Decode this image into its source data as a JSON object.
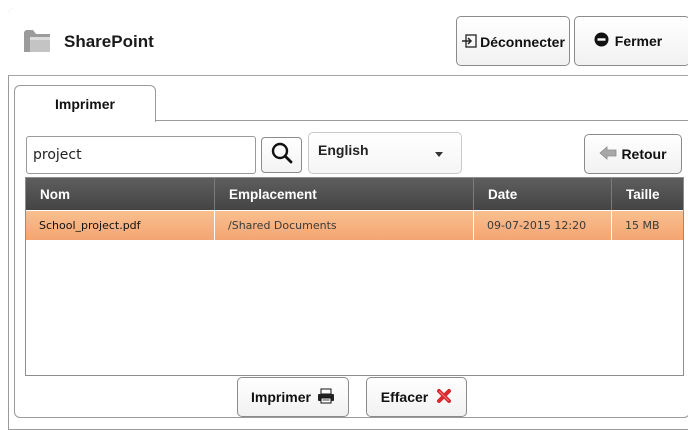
{
  "app": {
    "title": "SharePoint"
  },
  "header": {
    "disconnect_label": "Déconnecter",
    "close_label": "Fermer"
  },
  "tabs": [
    {
      "label": "Imprimer"
    }
  ],
  "search": {
    "value": "project",
    "placeholder": ""
  },
  "language": {
    "selected": "English"
  },
  "back_label": "Retour",
  "table": {
    "columns": [
      "Nom",
      "Emplacement",
      "Date",
      "Taille"
    ],
    "rows": [
      {
        "name": "School_project.pdf",
        "location": "/Shared Documents",
        "date": "09-07-2015 12:20",
        "size": "15 MB"
      }
    ]
  },
  "actions": {
    "print_label": "Imprimer",
    "clear_label": "Effacer"
  },
  "icons": {
    "app": "folder-icon",
    "disconnect": "logout-icon",
    "close": "stop-icon",
    "search": "magnifier-icon",
    "back": "arrow-left-icon",
    "print": "printer-icon",
    "clear": "red-x-icon"
  },
  "colors": {
    "selected_row": "#f6ad7b",
    "table_header": "#525252",
    "clear_icon": "#d8282b"
  }
}
